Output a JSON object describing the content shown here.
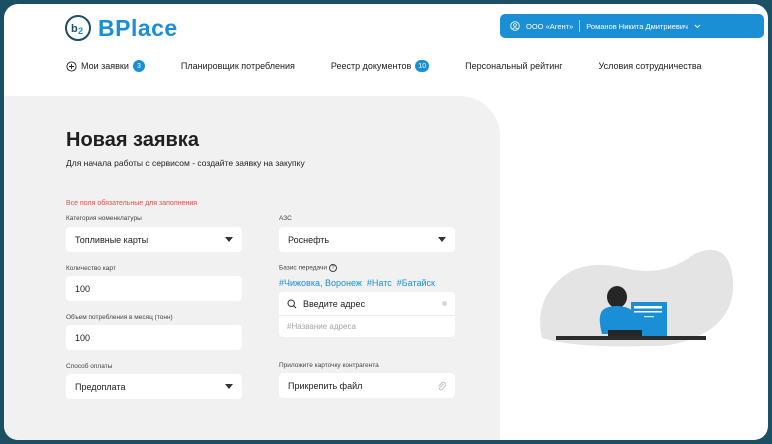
{
  "brand": {
    "name": "BPlace",
    "color": "#1b8fd6"
  },
  "user": {
    "company": "ООО «Агент»",
    "name": "Романов Никита Дмитриевич"
  },
  "nav": {
    "items": [
      {
        "label": "Мои заявки",
        "badge": "3",
        "icon": "plus-circle-icon"
      },
      {
        "label": "Планировщик потребления"
      },
      {
        "label": "Реестр документов",
        "badge": "10"
      },
      {
        "label": "Персональный рейтинг"
      },
      {
        "label": "Условия сотрудничества"
      }
    ]
  },
  "form": {
    "title": "Новая заявка",
    "subtitle": "Для начала работы с сервисом - создайте заявку на закупку",
    "required_note": "Все поля обязательные для заполнения",
    "category": {
      "label": "Категория номенклатуры",
      "value": "Топливные карты"
    },
    "station": {
      "label": "АЗС",
      "value": "Роснефть"
    },
    "card_count": {
      "label": "Количество карт",
      "value": "100"
    },
    "basis": {
      "label": "Базис передачи",
      "tags": [
        "#Чижовка, Воронеж",
        "#Натс",
        "#Батайск"
      ]
    },
    "monthly": {
      "label": "Объем потребления в месяц (тонн)",
      "value": "100"
    },
    "address": {
      "search_placeholder": "Введите адрес",
      "name_placeholder": "#Название адреса"
    },
    "payment": {
      "label": "Способ оплаты",
      "value": "Предоплата"
    },
    "attachment": {
      "label": "Приложите карточку контрагента",
      "value": "Прикрепить файл"
    }
  }
}
